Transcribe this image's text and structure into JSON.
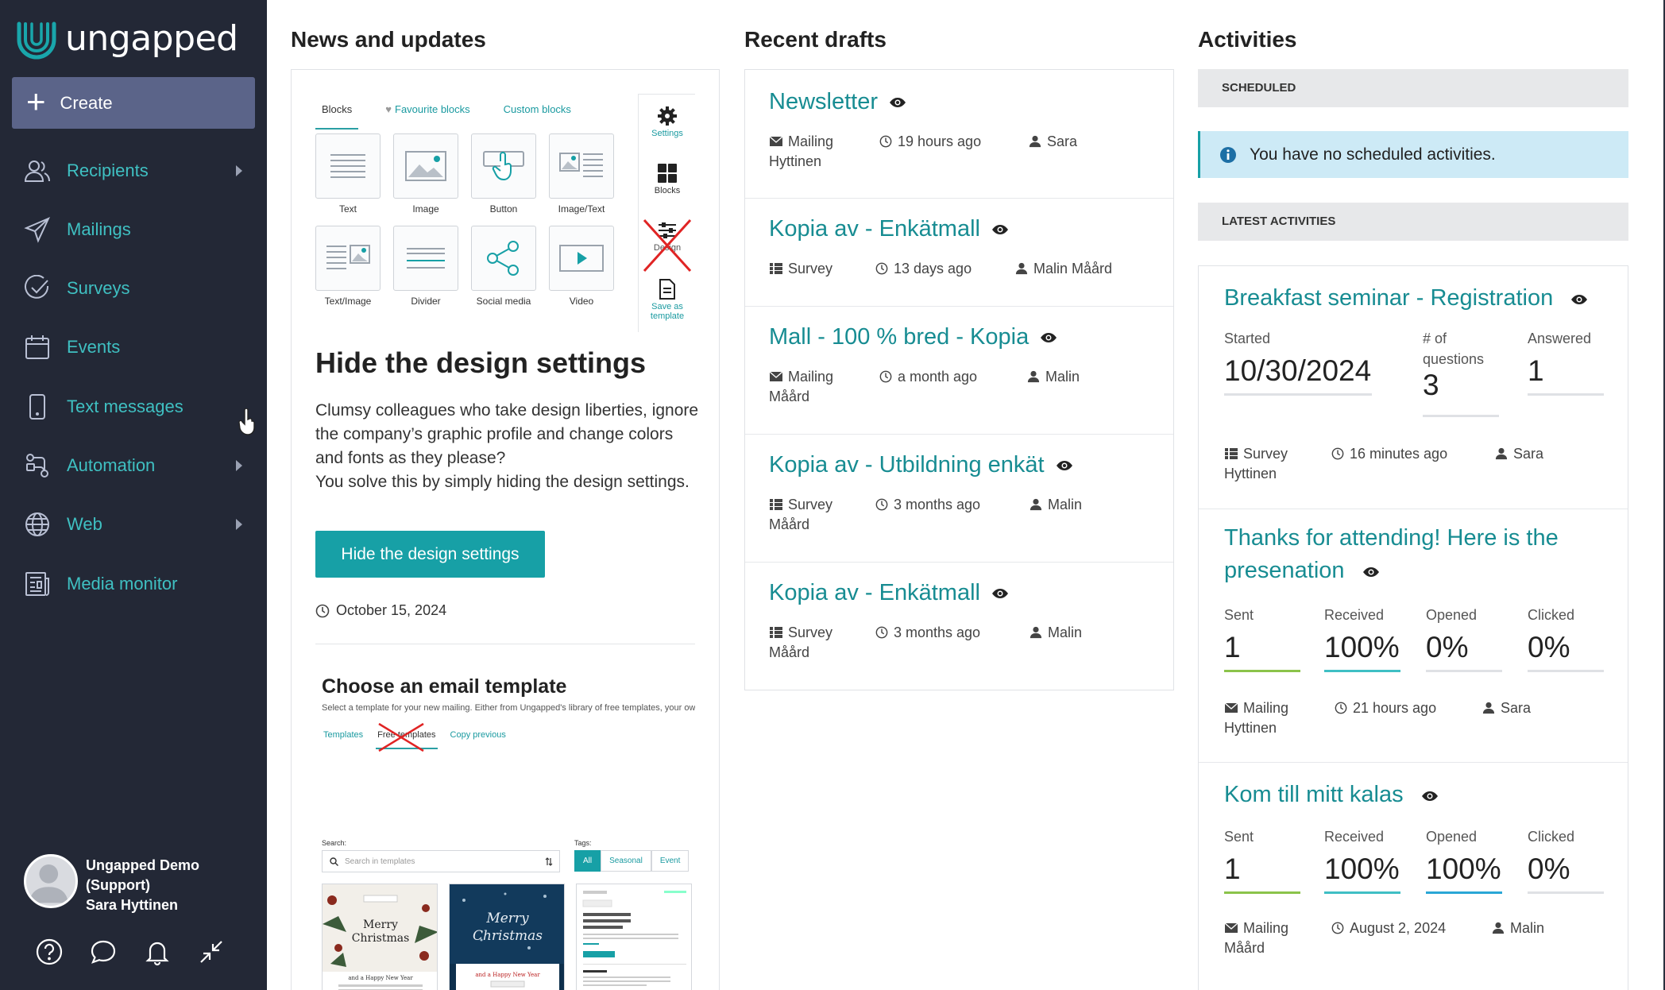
{
  "app": {
    "logo_text": "ungapped",
    "brand_color": "#17a0a6",
    "sidebar_bg": "#232836"
  },
  "sidebar": {
    "create_label": "Create",
    "items": [
      {
        "label": "Recipients",
        "icon": "users-icon",
        "has_submenu": true
      },
      {
        "label": "Mailings",
        "icon": "paper-plane-icon",
        "has_submenu": false
      },
      {
        "label": "Surveys",
        "icon": "check-circle-icon",
        "has_submenu": false
      },
      {
        "label": "Events",
        "icon": "calendar-icon",
        "has_submenu": false
      },
      {
        "label": "Text messages",
        "icon": "mobile-phone-icon",
        "has_submenu": false
      },
      {
        "label": "Automation",
        "icon": "automation-icon",
        "has_submenu": true
      },
      {
        "label": "Web",
        "icon": "globe-icon",
        "has_submenu": true
      },
      {
        "label": "Media monitor",
        "icon": "newspaper-icon",
        "has_submenu": false
      }
    ],
    "profile": {
      "org_line1": "Ungapped Demo",
      "org_line2": "(Support)",
      "name": "Sara Hyttinen"
    },
    "bottom_icons": [
      "help-icon",
      "chat-icon",
      "bell-icon",
      "collapse-icon"
    ]
  },
  "news": {
    "title": "News and updates",
    "mock_tabs": [
      "Blocks",
      "Favourite blocks",
      "Custom blocks"
    ],
    "mock_blocks": [
      "Text",
      "Image",
      "Button",
      "Image/Text",
      "Text/Image",
      "Divider",
      "Social media",
      "Video"
    ],
    "mock_side": [
      "Settings",
      "Blocks",
      "Design",
      "Save as template"
    ],
    "heading": "Hide the design settings",
    "paragraph1": "Clumsy colleagues who take design liberties, ignore the company’s graphic profile and change colors and fonts as they please?",
    "paragraph2": "You solve this by simply hiding the design settings.",
    "button_label": "Hide the design settings",
    "date": "October 15, 2024",
    "template_mock": {
      "heading": "Choose an email template",
      "subtitle": "Select a template for your new mailing. Either from Ungapped's library of free templates, your own saved te",
      "tabs": [
        "Templates",
        "Free templates",
        "Copy previous"
      ],
      "search_label": "Search:",
      "search_placeholder": "Search in templates",
      "tags_label": "Tags:",
      "tags": [
        "All",
        "Seasonal",
        "Event"
      ]
    }
  },
  "drafts": {
    "title": "Recent drafts",
    "items": [
      {
        "title": "Newsletter",
        "type": "Mailing",
        "type_icon": "envelope-icon",
        "time": "19 hours ago",
        "user_first": "Sara",
        "user_last": "Hyttinen"
      },
      {
        "title": "Kopia av - Enkätmall",
        "type": "Survey",
        "type_icon": "list-icon",
        "time": "13 days ago",
        "user_first": "Malin Måård",
        "user_last": ""
      },
      {
        "title": "Mall - 100 % bred - Kopia",
        "type": "Mailing",
        "type_icon": "envelope-icon",
        "time": "a month ago",
        "user_first": "Malin",
        "user_last": "Måård"
      },
      {
        "title": "Kopia av - Utbildning enkät",
        "type": "Survey",
        "type_icon": "list-icon",
        "time": "3 months ago",
        "user_first": "Malin",
        "user_last": "Måård"
      },
      {
        "title": "Kopia av - Enkätmall",
        "type": "Survey",
        "type_icon": "list-icon",
        "time": "3 months ago",
        "user_first": "Malin",
        "user_last": "Måård"
      }
    ]
  },
  "activities": {
    "title": "Activities",
    "scheduled_header": "SCHEDULED",
    "no_scheduled": "You have no scheduled activities.",
    "latest_header": "LATEST ACTIVITIES",
    "items": [
      {
        "title": "Breakfast seminar - Registration",
        "stats": [
          {
            "label": "Started",
            "value": "10/30/2024"
          },
          {
            "label": "# of questions",
            "value": "3"
          },
          {
            "label": "Answered",
            "value": "1"
          }
        ],
        "type": "Survey",
        "time": "16 minutes ago",
        "user_first": "Sara",
        "user_last": "Hyttinen"
      },
      {
        "title": "Thanks for attending! Here is the presenation",
        "stats": [
          {
            "label": "Sent",
            "value": "1"
          },
          {
            "label": "Received",
            "value": "100%"
          },
          {
            "label": "Opened",
            "value": "0%"
          },
          {
            "label": "Clicked",
            "value": "0%"
          }
        ],
        "type": "Mailing",
        "time": "21 hours ago",
        "user_first": "Sara",
        "user_last": "Hyttinen"
      },
      {
        "title": "Kom till mitt kalas",
        "stats": [
          {
            "label": "Sent",
            "value": "1"
          },
          {
            "label": "Received",
            "value": "100%"
          },
          {
            "label": "Opened",
            "value": "100%"
          },
          {
            "label": "Clicked",
            "value": "0%"
          }
        ],
        "type": "Mailing",
        "time": "August 2, 2024",
        "user_first": "Malin",
        "user_last": "Måård"
      }
    ]
  }
}
